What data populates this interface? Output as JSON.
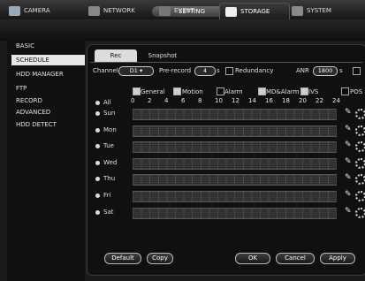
{
  "title": "SETTING",
  "topnav": [
    {
      "label": "CAMERA",
      "icon": "camera-icon",
      "active": false
    },
    {
      "label": "NETWORK",
      "icon": "network-icon",
      "active": false
    },
    {
      "label": "EVENT",
      "icon": "event-icon",
      "active": false
    },
    {
      "label": "STORAGE",
      "icon": "storage-icon",
      "active": true
    },
    {
      "label": "SYSTEM",
      "icon": "system-icon",
      "active": false
    }
  ],
  "sidebar": {
    "items": [
      "BASIC",
      "SCHEDULE",
      "HDD MANAGER",
      "FTP",
      "RECORD",
      "ADVANCED",
      "HDD DETECT"
    ],
    "selected": "SCHEDULE"
  },
  "subtabs": [
    "Rec",
    "Snapshot"
  ],
  "controls": {
    "channel_label": "Channel",
    "channel_value": "D1",
    "prerecord_label": "Pre-record",
    "prerecord_value": "4",
    "prerecord_unit": "s",
    "redundancy_label": "Redundancy",
    "anr_label": "ANR",
    "anr_value": "1800",
    "anr_unit": "s"
  },
  "types": [
    {
      "label": "General",
      "checked": true
    },
    {
      "label": "Motion",
      "checked": true
    },
    {
      "label": "Alarm",
      "checked": false
    },
    {
      "label": "MD&Alarm",
      "checked": true
    },
    {
      "label": "IVS",
      "checked": true
    },
    {
      "label": "POS",
      "checked": false
    }
  ],
  "hours": [
    "0",
    "2",
    "4",
    "6",
    "8",
    "10",
    "12",
    "14",
    "16",
    "18",
    "20",
    "22",
    "24"
  ],
  "days": [
    "All",
    "Sun",
    "Mon",
    "Tue",
    "Wed",
    "Thu",
    "Fri",
    "Sat"
  ],
  "buttons": {
    "default": "Default",
    "copy": "Copy",
    "ok": "OK",
    "cancel": "Cancel",
    "apply": "Apply"
  }
}
